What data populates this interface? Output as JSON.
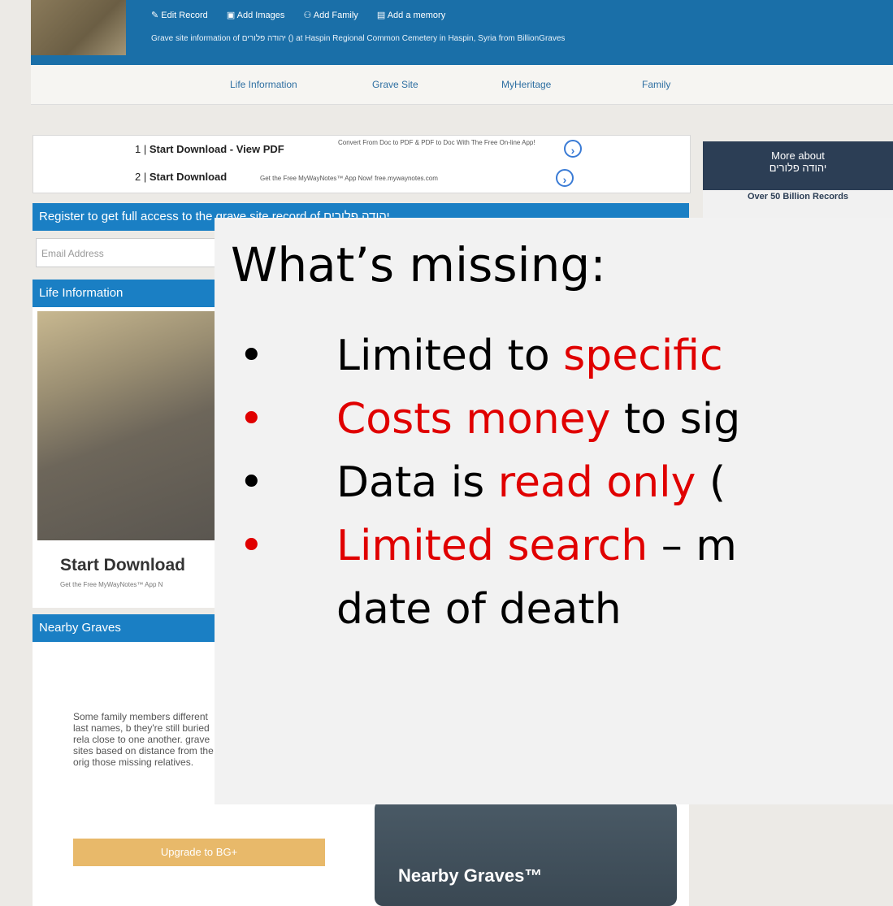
{
  "header": {
    "actions": [
      "Edit Record",
      "Add Images",
      "Add Family",
      "Add a memory"
    ],
    "subtitle": "Grave site information of יהודה פלורים () at Haspin Regional Common Cemetery in Haspin, Syria from BillionGraves"
  },
  "nav": [
    "Life Information",
    "Grave Site",
    "MyHeritage",
    "Family"
  ],
  "ad": {
    "line1_num": "1",
    "line1_title": "Start Download - View PDF",
    "line1_small": "Convert From Doc to PDF & PDF to Doc With The Free On-line App!",
    "line2_num": "2",
    "line2_title": "Start Download",
    "line2_small": "Get the Free MyWayNotes™ App Now! free.mywaynotes.com"
  },
  "register_bar": "Register to get full access to the grave site record of יהודה פלורים",
  "email_placeholder": "Email Address",
  "life_info_bar": "Life Information",
  "start_download": {
    "title": "Start Download",
    "sub": "Get the Free MyWayNotes™ App N"
  },
  "nearby_bar": "Nearby Graves",
  "nearby_text": "Some family members different last names, b they're still buried rela close to one another. grave sites based on distance from the orig those missing relatives.",
  "upgrade_label": "Upgrade to BG+",
  "nearby_image_title": "Nearby Graves™",
  "more_about": {
    "line1": "More about",
    "line2": "יהודה פלורים"
  },
  "records_label": "Over 50 Billion Records",
  "overlay": {
    "title": "What’s missing:",
    "b1_a": "Limited to ",
    "b1_b": "specific",
    "b2_a": "Costs money",
    "b2_b": " to sig",
    "b3_a": "Data is ",
    "b3_b": "read only",
    "b3_c": " (",
    "b4_a": "Limited search",
    "b4_b": " – m",
    "b4_cont": "date of death"
  },
  "colors": {
    "header_blue": "#1a6fa8",
    "bar_blue": "#1a7fc4",
    "highlight_red": "#e00000"
  }
}
